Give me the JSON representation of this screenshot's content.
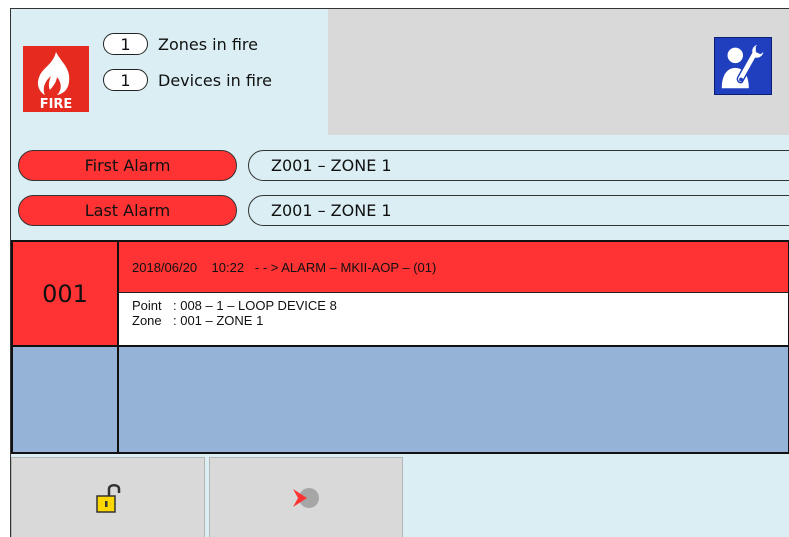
{
  "header": {
    "fire_icon_label": "FIRE",
    "zones_in_fire": {
      "count": "1",
      "label": "Zones in fire"
    },
    "devices_in_fire": {
      "count": "1",
      "label": "Devices in fire"
    },
    "service_icon": "maintenance-wrench-person-icon"
  },
  "alarms": {
    "first": {
      "label": "First Alarm",
      "zone": "Z001 – ZONE 1"
    },
    "last": {
      "label": "Last Alarm",
      "zone": "Z001 – ZONE 1"
    }
  },
  "events": [
    {
      "number": "001",
      "header": "2018/06/20    10:22   - - > ALARM – MKII-AOP – (01)",
      "point_key": "Point",
      "point_value": ": 008 – 1 – LOOP DEVICE 8",
      "zone_key": "Zone",
      "zone_value": ": 001 – ZONE 1"
    }
  ],
  "buttons": {
    "unlock_icon": "padlock-open-icon",
    "silence_icon": "silence-buzzer-icon"
  },
  "colors": {
    "background": "#daeef3",
    "alarm_red": "#ff3333",
    "empty_event_blue": "#95b3d7",
    "panel_grey": "#d9d9d9",
    "service_blue": "#1f3fbf"
  }
}
